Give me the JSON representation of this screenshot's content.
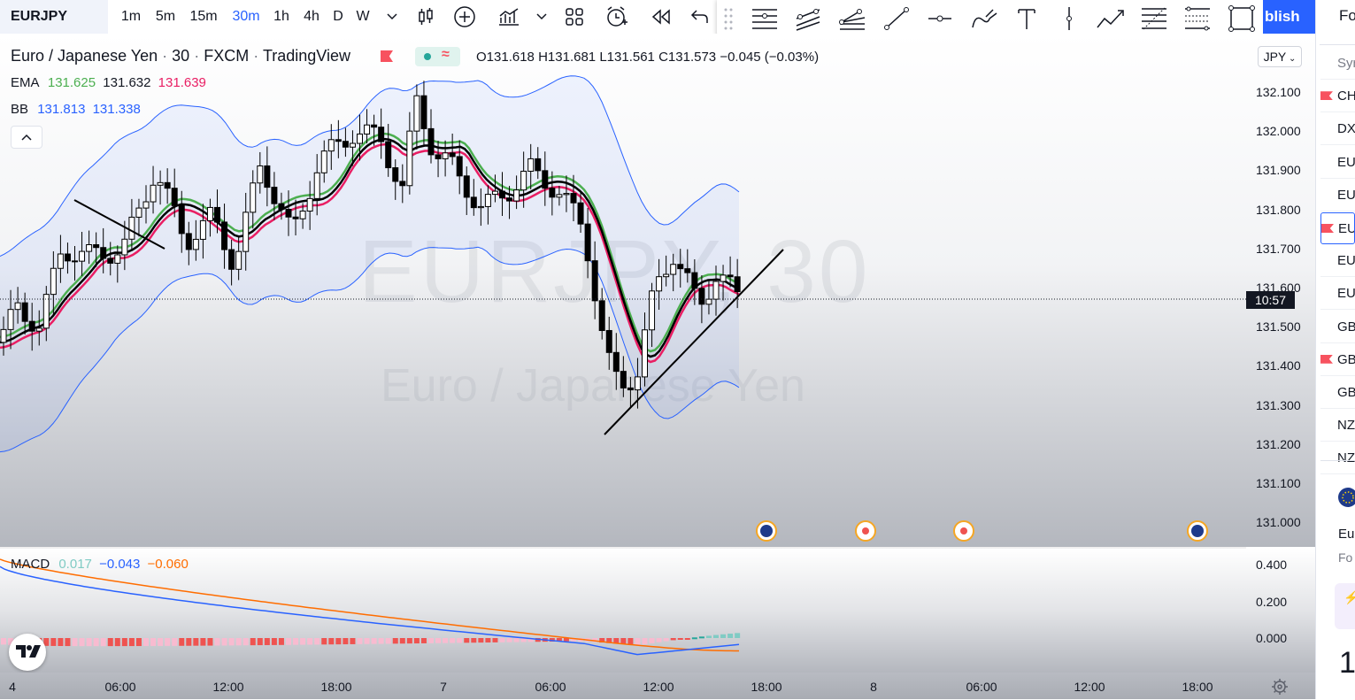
{
  "toolbar": {
    "symbol": "EURJPY",
    "timeframes": [
      "1m",
      "5m",
      "15m",
      "30m",
      "1h",
      "4h",
      "D",
      "W"
    ],
    "active_timeframe": "30m",
    "publish_label": "blish"
  },
  "legend": {
    "title": "Euro / Japanese Yen",
    "interval": "30",
    "source": "FXCM",
    "provider": "TradingView",
    "ohlc": {
      "o_label": "O",
      "o": "131.618",
      "h_label": "H",
      "h": "131.681",
      "l_label": "L",
      "l": "131.561",
      "c_label": "C",
      "c": "131.573",
      "change": "−0.045 (−0.03%)"
    },
    "ema": {
      "label": "EMA",
      "v1": "131.625",
      "v2": "131.632",
      "v3": "131.639"
    },
    "bb": {
      "label": "BB",
      "v1": "131.813",
      "v2": "131.338"
    },
    "macd": {
      "label": "MACD",
      "v1": "0.017",
      "v2": "−0.043",
      "v3": "−0.060"
    }
  },
  "watermark": {
    "symbol": "EURJPY, 30",
    "name": "Euro / Japanese Yen"
  },
  "currency": "JPY",
  "price_scale": [
    "132.100",
    "132.000",
    "131.900",
    "131.800",
    "131.700",
    "131.600",
    "131.500",
    "131.400",
    "131.300",
    "131.200",
    "131.100",
    "131.000"
  ],
  "countdown": "10:57",
  "macd_scale": [
    "0.400",
    "0.200",
    "0.000"
  ],
  "time_scale": [
    "4",
    "06:00",
    "12:00",
    "18:00",
    "7",
    "06:00",
    "12:00",
    "18:00",
    "8",
    "06:00",
    "12:00",
    "18:00"
  ],
  "watchlist": {
    "header": "Fo",
    "items": [
      "Syr",
      "CH",
      "DX",
      "EU",
      "EU",
      "EU",
      "EU",
      "EU",
      "GB",
      "GB",
      "GB",
      "NZ",
      "NZ"
    ],
    "detail_name": "Eur",
    "detail_type": "Fo",
    "detail_price": "1"
  },
  "colors": {
    "ema_green": "#4caf50",
    "ema_black": "#000000",
    "ema_red": "#e91e63",
    "bb": "#2962ff",
    "macd_line": "#2962ff",
    "signal_line": "#ff6d00",
    "hist_up": "#26a69a",
    "hist_down": "#ef5350",
    "accent": "#2962ff"
  },
  "icons": [
    "bar-style-icon",
    "add-indicator-icon",
    "indicators-icon",
    "layout-icon",
    "alert-icon",
    "replay-icon",
    "undo-icon",
    "horizontal-lines-icon",
    "parallel-channel-icon",
    "pitchfork-icon",
    "trend-line-icon",
    "horizontal-ray-icon",
    "brush-icon",
    "text-icon",
    "vertical-line-icon",
    "path-icon",
    "fib-icon",
    "date-range-icon",
    "rectangle-icon",
    "settings-icon",
    "tradingview-logo-icon"
  ]
}
